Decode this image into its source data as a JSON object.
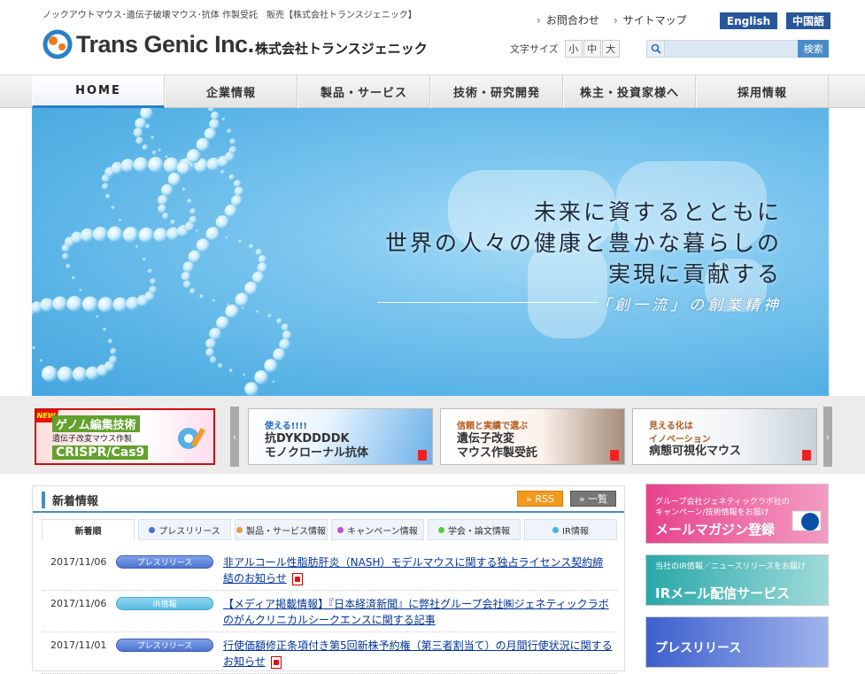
{
  "header": {
    "tagline": "ノックアウトマウス･遺伝子破壊マウス･抗体 作製受託　販売【株式会社トランスジェニック】",
    "logo_text": "Trans Genic Inc.",
    "company_jp": "株式会社トランスジェニック",
    "links": [
      "お問合わせ",
      "サイトマップ"
    ],
    "lang_en": "English",
    "lang_cn": "中国語",
    "font_size_label": "文字サイズ",
    "font_sizes": [
      "小",
      "中",
      "大"
    ],
    "search_button": "検索",
    "search_value": ""
  },
  "nav": {
    "items": [
      "HOME",
      "企業情報",
      "製品・サービス",
      "技術・研究開発",
      "株主・投資家様へ",
      "採用情報"
    ]
  },
  "hero": {
    "line1": "未来に資するとともに",
    "line2": "世界の人々の健康と豊かな暮らしの",
    "line3": "実現に貢献する",
    "line4": "「創一流」の創業精神"
  },
  "banners": {
    "b1": {
      "badge": "NEW",
      "title": "ゲノム編集技術",
      "sub": "遺伝子改変マウス作製",
      "main": "CRISPR/Cas9"
    },
    "b2": {
      "small": "使える!!!!",
      "line1": "抗DYKDDDDK",
      "line2": "モノクローナル抗体"
    },
    "b3": {
      "small": "信頼と実績で選ぶ",
      "line1": "遺伝子改変",
      "line2": "マウス作製受託"
    },
    "b4": {
      "small": "見える化は",
      "small2": "イノベーション",
      "line1": "病態可視化マウス"
    },
    "prev": "‹",
    "next": "›"
  },
  "news": {
    "title": "新着情報",
    "rss": "RSS",
    "list": "一覧",
    "tabs": [
      {
        "label": "新着順",
        "dot": ""
      },
      {
        "label": "プレスリリース",
        "dot": "#4a6fd6"
      },
      {
        "label": "製品・サービス情報",
        "dot": "#e0a040"
      },
      {
        "label": "キャンペーン情報",
        "dot": "#c050c8"
      },
      {
        "label": "学会・論文情報",
        "dot": "#60c840"
      },
      {
        "label": "IR情報",
        "dot": "#40b8e0"
      }
    ],
    "items": [
      {
        "date": "2017/11/06",
        "category": "プレスリリース",
        "title": "非アルコール性脂肪肝炎（NASH）モデルマウスに関する独占ライセンス契約締結のお知らせ"
      },
      {
        "date": "2017/11/06",
        "category": "IR情報",
        "title": "【メディア掲載情報】『日本経済新聞』に弊社グループ会社㈱ジェネティックラボのがんクリニカルシークエンスに関する記事"
      },
      {
        "date": "2017/11/01",
        "category": "プレスリリース",
        "title": "行使価額修正条項付き第5回新株予約権（第三者割当て）の月間行使状況に関するお知らせ"
      }
    ]
  },
  "side": {
    "s1": {
      "small1": "グループ会社ジェネティックラボ社の",
      "small2": "キャンペーン/技術情報をお届け",
      "big": "メールマガジン登録"
    },
    "s2": {
      "small1": "当社のIR情報／ニュースリリースをお届け",
      "big": "IRメール配信サービス"
    },
    "s3": {
      "big": "プレスリリース"
    }
  },
  "colors": {
    "brand_blue": "#27569b",
    "accent": "#4a8bc7",
    "rss": "#f29a1e"
  }
}
